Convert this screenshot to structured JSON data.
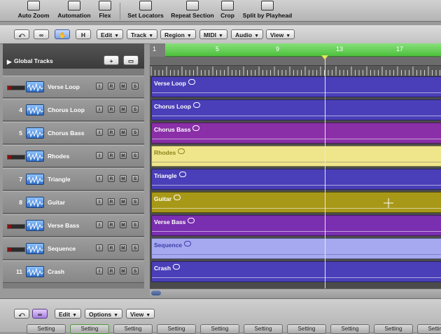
{
  "top_toolbar": {
    "items": [
      {
        "label": "Auto Zoom"
      },
      {
        "label": "Automation"
      },
      {
        "label": "Flex"
      },
      {
        "label": "Set Locators"
      },
      {
        "label": "Repeat Section"
      },
      {
        "label": "Crop"
      },
      {
        "label": "Split by Playhead"
      }
    ]
  },
  "arrange_toolbar": {
    "back_icon": "arrow-icon",
    "link_icon": "link-icon",
    "catch_icon": "pointer-icon",
    "hide_label": "H",
    "menus": [
      {
        "label": "Edit"
      },
      {
        "label": "Track"
      },
      {
        "label": "Region"
      },
      {
        "label": "MIDI"
      },
      {
        "label": "Audio"
      },
      {
        "label": "View"
      }
    ]
  },
  "global_tracks": {
    "label": "Global Tracks",
    "add_label": "+"
  },
  "track_buttons": {
    "input": "I",
    "record": "R",
    "mute": "M",
    "solo": "S"
  },
  "tracks": [
    {
      "number": "",
      "name": "Verse Loop",
      "armed": true
    },
    {
      "number": "4",
      "name": "Chorus Loop",
      "armed": false
    },
    {
      "number": "5",
      "name": "Chorus Bass",
      "armed": false
    },
    {
      "number": "",
      "name": "Rhodes",
      "armed": true
    },
    {
      "number": "7",
      "name": "Triangle",
      "armed": false
    },
    {
      "number": "8",
      "name": "Guitar",
      "armed": false
    },
    {
      "number": "",
      "name": "Verse Bass",
      "armed": true
    },
    {
      "number": "",
      "name": "Sequence",
      "armed": true
    },
    {
      "number": "11",
      "name": "Crash",
      "armed": false
    }
  ],
  "ruler": {
    "bars": [
      "1",
      "5",
      "9",
      "13",
      "17"
    ]
  },
  "regions": [
    {
      "name": "Verse Loop",
      "color": "#4a3fb8",
      "text": "#ffffff"
    },
    {
      "name": "Chorus Loop",
      "color": "#4a3fb8",
      "text": "#ffffff"
    },
    {
      "name": "Chorus Bass",
      "color": "#8a2fa8",
      "text": "#ffffff"
    },
    {
      "name": "Rhodes",
      "color": "#efe58a",
      "text": "#8c8420"
    },
    {
      "name": "Triangle",
      "color": "#4a3fb8",
      "text": "#ffffff"
    },
    {
      "name": "Guitar",
      "color": "#a89818",
      "text": "#ffffff"
    },
    {
      "name": "Verse Bass",
      "color": "#7a2eb0",
      "text": "#ffffff"
    },
    {
      "name": "Sequence",
      "color": "#a6a8f0",
      "text": "#3a3ea8"
    },
    {
      "name": "Crash",
      "color": "#4a3fb8",
      "text": "#ffffff"
    }
  ],
  "lower_toolbar": {
    "back_icon": "arrow-icon",
    "link_icon": "link-icon",
    "menus": [
      {
        "label": "Edit"
      },
      {
        "label": "Options"
      },
      {
        "label": "View"
      }
    ]
  },
  "settings": [
    "Setting",
    "Setting",
    "Setting",
    "Setting",
    "Setting",
    "Setting",
    "Setting",
    "Setting",
    "Setting",
    "Setting"
  ],
  "colors": {
    "cycle_green": "#4ec03e",
    "playhead_marker": "#e4e85c"
  }
}
